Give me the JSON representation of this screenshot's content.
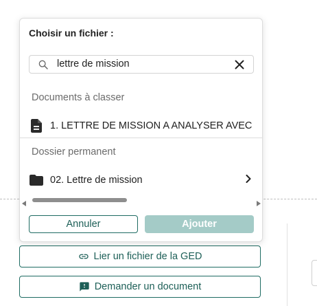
{
  "dialog": {
    "title": "Choisir un fichier :",
    "search": {
      "value": "lettre de mission",
      "icon": "search-icon",
      "clear_icon": "close-icon"
    },
    "groups": [
      {
        "label": "Documents à classer",
        "items": [
          {
            "label": "1. LETTRE DE MISSION A ANALYSER AVEC",
            "icon": "document-icon"
          }
        ]
      },
      {
        "label": "Dossier permanent",
        "items": [
          {
            "label": "02. Lettre de mission",
            "icon": "folder-icon"
          }
        ]
      }
    ],
    "buttons": {
      "cancel": "Annuler",
      "add": "Ajouter"
    }
  },
  "page": {
    "link_button": {
      "label": "Lier un fichier de la GED",
      "icon": "link-icon"
    },
    "request_button": {
      "label": "Demander un document",
      "icon": "feedback-icon"
    }
  },
  "colors": {
    "accent": "#1e6b62",
    "disabled_primary": "#a4cbc7"
  }
}
